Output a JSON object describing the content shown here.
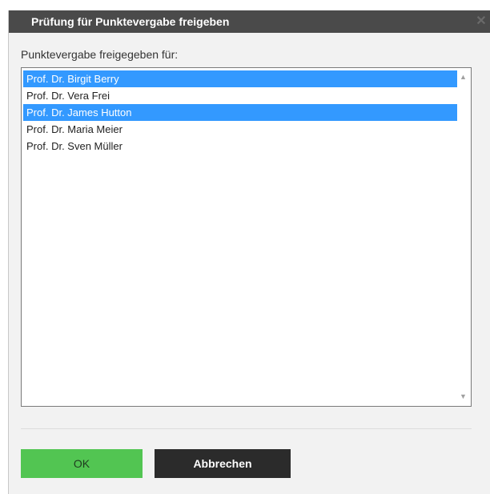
{
  "dialog": {
    "title": "Prüfung für Punktevergabe freigeben",
    "close_icon": "close-icon"
  },
  "list": {
    "label": "Punktevergabe freigegeben für:",
    "items": [
      {
        "label": "Prof. Dr. Birgit Berry",
        "selected": true
      },
      {
        "label": "Prof. Dr. Vera Frei",
        "selected": false
      },
      {
        "label": "Prof. Dr. James Hutton",
        "selected": true
      },
      {
        "label": "Prof. Dr. Maria Meier",
        "selected": false
      },
      {
        "label": "Prof. Dr. Sven Müller",
        "selected": false
      }
    ]
  },
  "buttons": {
    "ok_label": "OK",
    "cancel_label": "Abbrechen"
  },
  "colors": {
    "titlebar": "#4a4a4a",
    "selection": "#3399ff",
    "ok_button": "#52c552",
    "cancel_button": "#2b2b2b"
  }
}
